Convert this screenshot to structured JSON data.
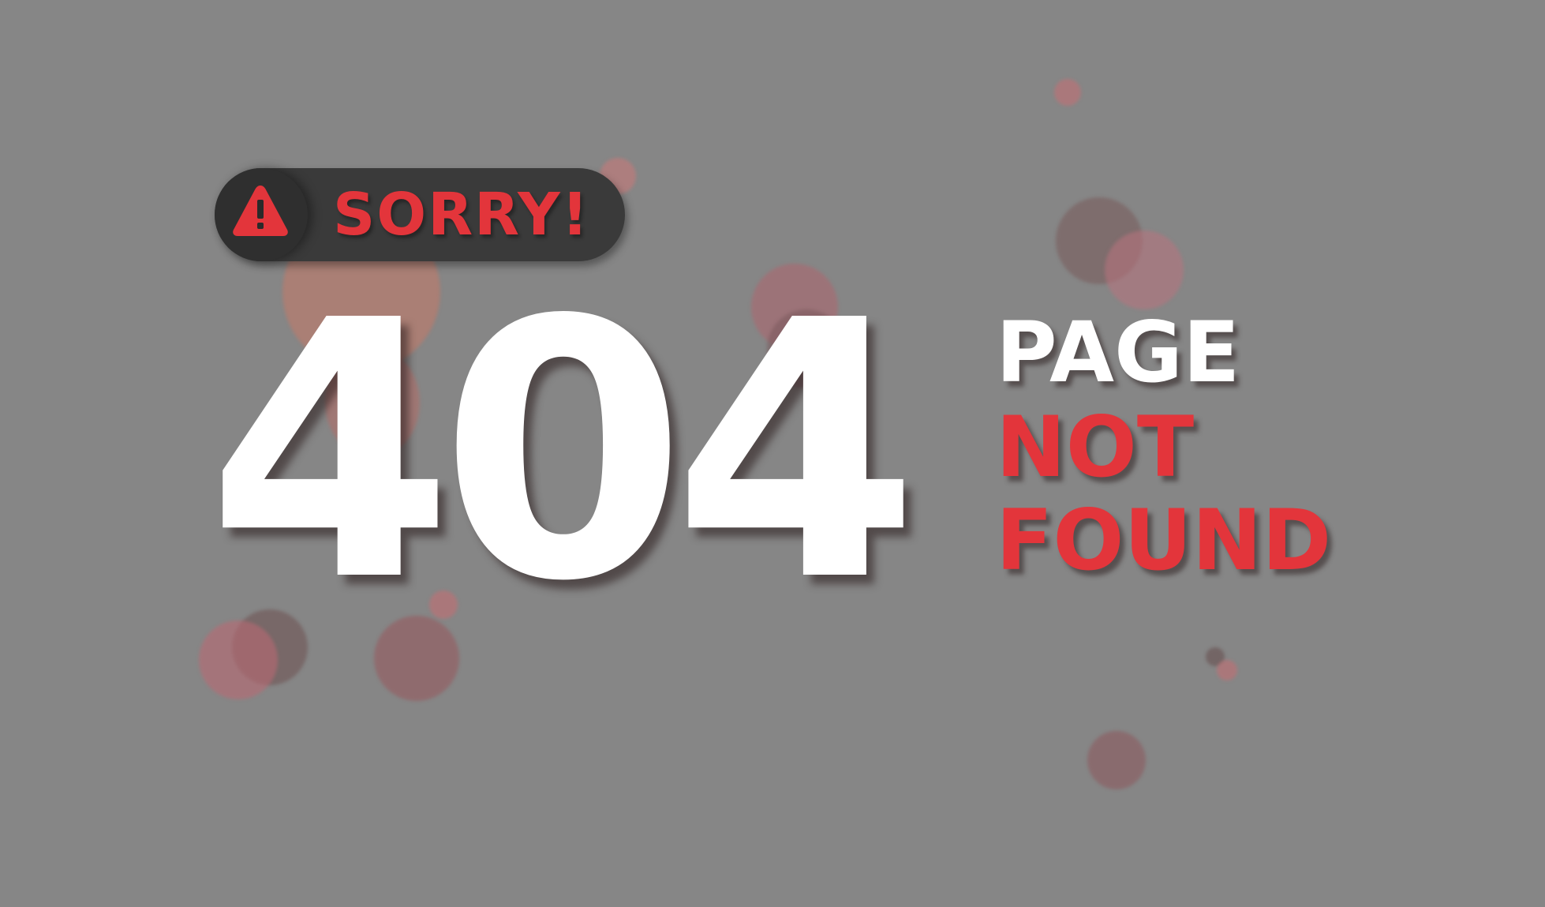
{
  "badge": {
    "icon": "warning-triangle-icon",
    "label": "SORRY!"
  },
  "error": {
    "code": "404",
    "line1": "PAGE",
    "line2": "NOT",
    "line3": "FOUND"
  },
  "colors": {
    "background": "#868686",
    "accent": "#e3353b",
    "primary_text": "#ffffff",
    "badge_bg": "#3a3a3a"
  }
}
